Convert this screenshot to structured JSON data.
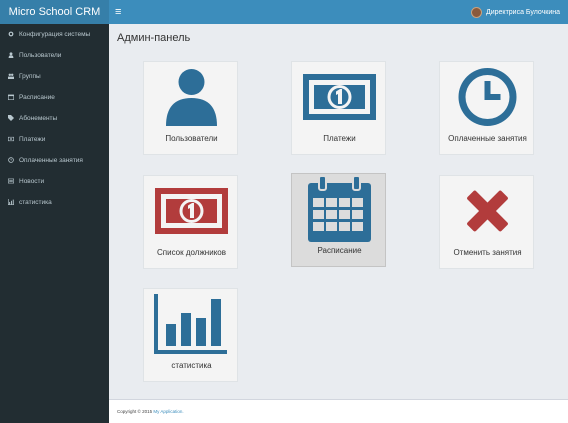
{
  "header": {
    "brand": "Micro School CRM",
    "menu_icon": "≡",
    "user_name": "Директриса Булочкина"
  },
  "sidebar": {
    "items": [
      {
        "label": "Конфигурация системы",
        "icon": "cogs-icon"
      },
      {
        "label": "Пользователи",
        "icon": "user-icon"
      },
      {
        "label": "Группы",
        "icon": "users-icon"
      },
      {
        "label": "Расписание",
        "icon": "calendar-icon"
      },
      {
        "label": "Абонементы",
        "icon": "tag-icon"
      },
      {
        "label": "Платежи",
        "icon": "money-icon"
      },
      {
        "label": "Оплаченные занятия",
        "icon": "clock-icon"
      },
      {
        "label": "Новости",
        "icon": "newspaper-icon"
      },
      {
        "label": "статистика",
        "icon": "bar-chart-icon"
      }
    ]
  },
  "main": {
    "title": "Админ-панель",
    "tiles": [
      {
        "label": "Пользователи",
        "icon": "user-icon",
        "color": "#2d6e98"
      },
      {
        "label": "Платежи",
        "icon": "money-icon",
        "color": "#2d6e98"
      },
      {
        "label": "Оплаченные занятия",
        "icon": "clock-icon",
        "color": "#2d6e98"
      },
      {
        "label": "Список должников",
        "icon": "money-icon",
        "color": "#b23c3c"
      },
      {
        "label": "Расписание",
        "icon": "calendar-icon",
        "color": "#2d6e98"
      },
      {
        "label": "Отменить занятия",
        "icon": "cross-icon",
        "color": "#b23c3c"
      },
      {
        "label": "статистика",
        "icon": "bar-chart-icon",
        "color": "#2d6e98"
      }
    ]
  },
  "footer": {
    "copyright": "Copyright © 2015",
    "link": "My Application."
  },
  "colors": {
    "topbar": "#3c8dbc",
    "sidebar": "#222d32",
    "blue_icon": "#2d6e98",
    "red_icon": "#b23c3c"
  }
}
